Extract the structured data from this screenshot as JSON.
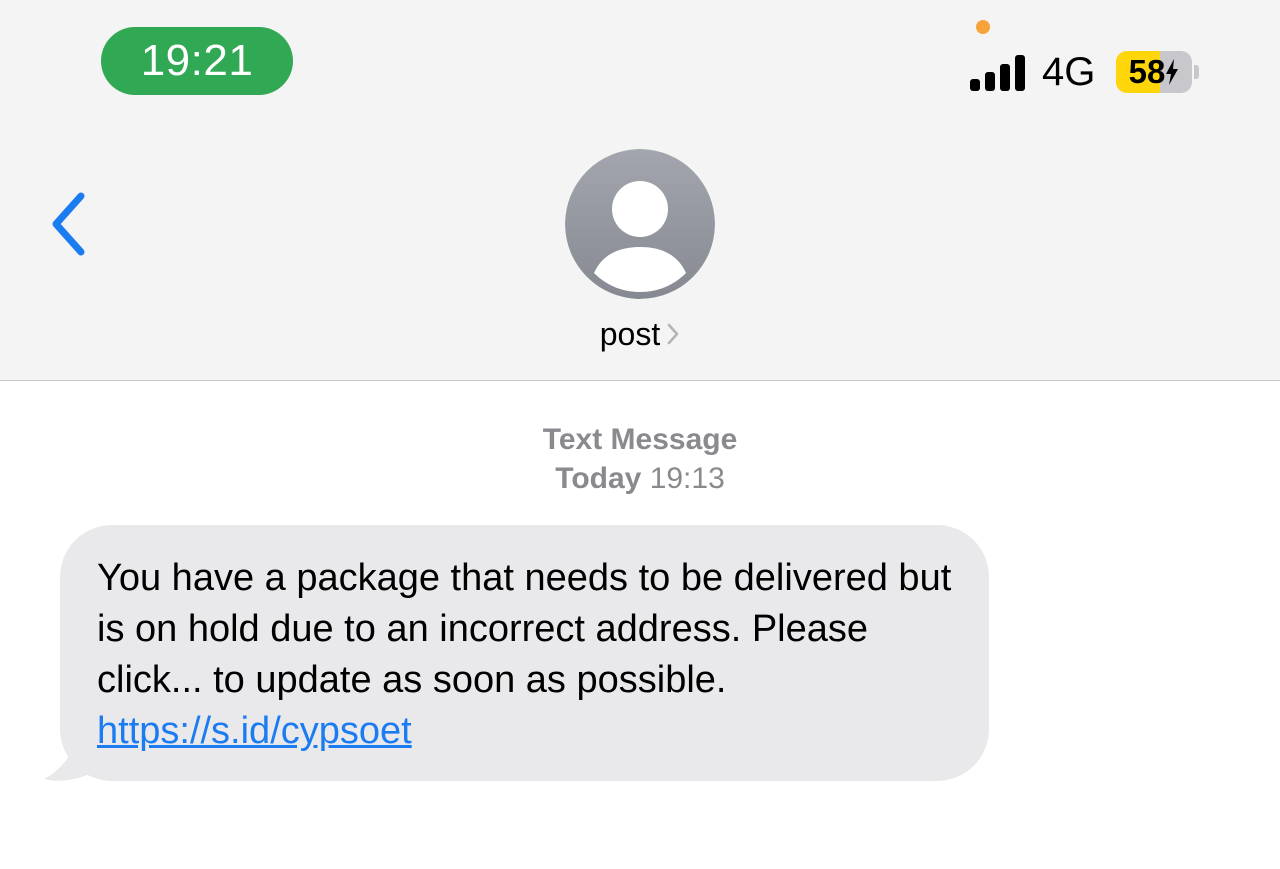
{
  "status_bar": {
    "time": "19:21",
    "network": "4G",
    "battery_percent": "58",
    "battery_level": 0.58,
    "signal_bars": 4,
    "colors": {
      "time_pill": "#30a854",
      "privacy_dot": "#f7a33a",
      "battery_fill": "#ffd60a"
    }
  },
  "nav": {
    "back_icon": "chevron-left-icon",
    "contact_name": "post",
    "contact_chevron_icon": "chevron-right-icon",
    "avatar_icon": "person-icon",
    "accent": "#1b7cf2"
  },
  "thread": {
    "message_type": "Text Message",
    "timestamp_day": "Today",
    "timestamp_time": "19:13",
    "messages": [
      {
        "text": "You have a package that needs to be delivered but is on hold due to an incorrect address. Please click... to update as soon as possible. ",
        "link": "https://s.id/cypsoet"
      }
    ]
  }
}
